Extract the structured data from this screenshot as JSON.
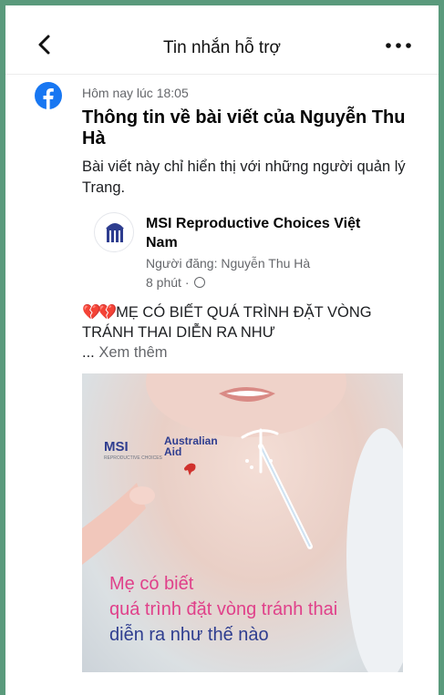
{
  "header": {
    "title": "Tin nhắn hỗ trợ"
  },
  "message": {
    "time": "Hôm nay lúc 18:05",
    "heading": "Thông tin về bài viết của Nguyễn Thu Hà",
    "description": "Bài viết này chỉ hiển thị với những người quản lý Trang."
  },
  "post": {
    "page_name": "MSI Reproductive Choices Việt Nam",
    "posted_by": "Người đăng: Nguyễn Thu Hà",
    "age": "8 phút ·",
    "hearts": "💔💔",
    "text": "MẸ CÓ BIẾT QUÁ TRÌNH ĐẶT VÒNG TRÁNH THAI DIỄN RA NHƯ",
    "ellipsis": "... ",
    "see_more": "Xem thêm"
  },
  "image": {
    "logo_msi": "MSI",
    "logo_msi_sub": "REPRODUCTIVE CHOICES",
    "logo_aus_1": "Australian",
    "logo_aus_2": "Aid",
    "caption_1": "Mẹ có biết",
    "caption_2": "quá trình đặt vòng tránh thai",
    "caption_3": "diễn ra như thế nào"
  },
  "colors": {
    "frame": "#5a9a7c",
    "facebook": "#1877f2",
    "caption_pink": "#e0408a",
    "caption_navy": "#2e3d8f"
  },
  "icons": [
    "back-chevron-icon",
    "more-dots-icon",
    "facebook-icon",
    "globe-icon",
    "broken-heart-icon"
  ]
}
